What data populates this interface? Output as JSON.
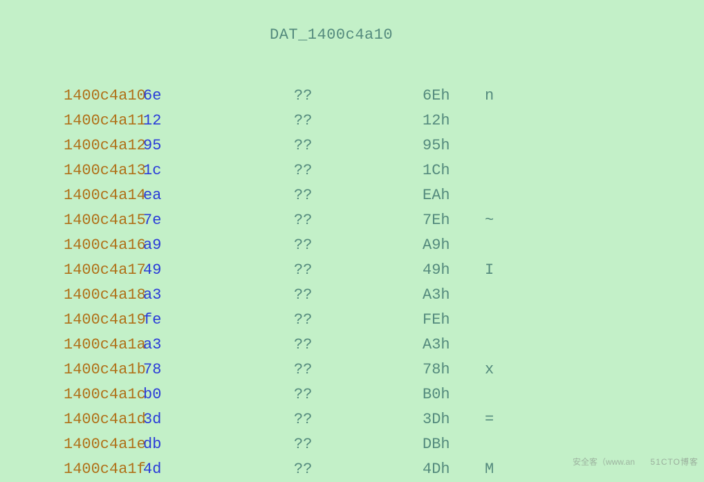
{
  "title": "DAT_1400c4a10",
  "rows": [
    {
      "addr": "1400c4a10",
      "byte": "6e",
      "mnemonic": "??",
      "hex": "6Eh",
      "ascii": "n"
    },
    {
      "addr": "1400c4a11",
      "byte": "12",
      "mnemonic": "??",
      "hex": "12h",
      "ascii": ""
    },
    {
      "addr": "1400c4a12",
      "byte": "95",
      "mnemonic": "??",
      "hex": "95h",
      "ascii": ""
    },
    {
      "addr": "1400c4a13",
      "byte": "1c",
      "mnemonic": "??",
      "hex": "1Ch",
      "ascii": ""
    },
    {
      "addr": "1400c4a14",
      "byte": "ea",
      "mnemonic": "??",
      "hex": "EAh",
      "ascii": ""
    },
    {
      "addr": "1400c4a15",
      "byte": "7e",
      "mnemonic": "??",
      "hex": "7Eh",
      "ascii": "~"
    },
    {
      "addr": "1400c4a16",
      "byte": "a9",
      "mnemonic": "??",
      "hex": "A9h",
      "ascii": ""
    },
    {
      "addr": "1400c4a17",
      "byte": "49",
      "mnemonic": "??",
      "hex": "49h",
      "ascii": "I"
    },
    {
      "addr": "1400c4a18",
      "byte": "a3",
      "mnemonic": "??",
      "hex": "A3h",
      "ascii": ""
    },
    {
      "addr": "1400c4a19",
      "byte": "fe",
      "mnemonic": "??",
      "hex": "FEh",
      "ascii": ""
    },
    {
      "addr": "1400c4a1a",
      "byte": "a3",
      "mnemonic": "??",
      "hex": "A3h",
      "ascii": ""
    },
    {
      "addr": "1400c4a1b",
      "byte": "78",
      "mnemonic": "??",
      "hex": "78h",
      "ascii": "x"
    },
    {
      "addr": "1400c4a1c",
      "byte": "b0",
      "mnemonic": "??",
      "hex": "B0h",
      "ascii": ""
    },
    {
      "addr": "1400c4a1d",
      "byte": "3d",
      "mnemonic": "??",
      "hex": "3Dh",
      "ascii": "="
    },
    {
      "addr": "1400c4a1e",
      "byte": "db",
      "mnemonic": "??",
      "hex": "DBh",
      "ascii": ""
    },
    {
      "addr": "1400c4a1f",
      "byte": "4d",
      "mnemonic": "??",
      "hex": "4Dh",
      "ascii": "M"
    }
  ],
  "watermark1": "安全客（www.an",
  "watermark2": "51CTO博客"
}
